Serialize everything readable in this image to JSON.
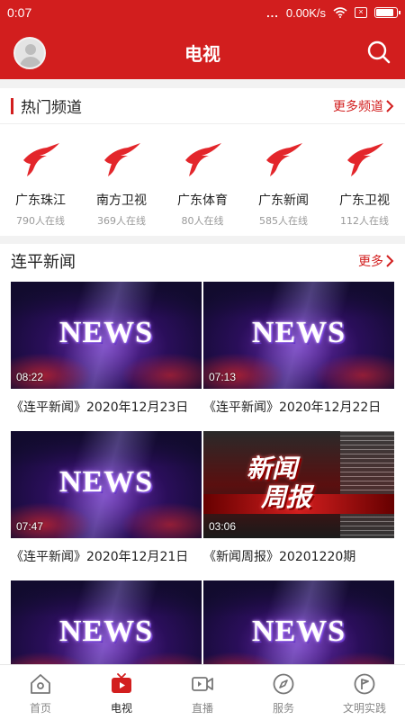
{
  "status_bar": {
    "time": "0:07",
    "signal_dots": "...",
    "net_speed": "0.00K/s",
    "battery_level": 0.9,
    "icons": [
      "wifi-icon",
      "sim-x-icon",
      "battery-icon"
    ]
  },
  "header": {
    "title": "电视",
    "left_icon": "avatar",
    "right_icon": "search-icon"
  },
  "hot_channels": {
    "title": "热门频道",
    "more_label": "更多频道",
    "items": [
      {
        "name": "广东珠江",
        "online": "790人在线"
      },
      {
        "name": "南方卫视",
        "online": "369人在线"
      },
      {
        "name": "广东体育",
        "online": "80人在线"
      },
      {
        "name": "广东新闻",
        "online": "585人在线"
      },
      {
        "name": "广东卫视",
        "online": "112人在线"
      }
    ]
  },
  "news_section": {
    "title": "连平新闻",
    "more_label": "更多",
    "videos": [
      {
        "title": "《连平新闻》2020年12月23日",
        "duration": "08:22",
        "thumb_text": "NEWS"
      },
      {
        "title": "《连平新闻》2020年12月22日",
        "duration": "07:13",
        "thumb_text": "NEWS"
      },
      {
        "title": "《连平新闻》2020年12月21日",
        "duration": "07:47",
        "thumb_text": "NEWS"
      },
      {
        "title": "《新闻周报》20201220期",
        "duration": "03:06",
        "thumb_text": "新闻周报"
      },
      {
        "title": "",
        "duration": "",
        "thumb_text": "NEWS"
      },
      {
        "title": "",
        "duration": "",
        "thumb_text": "NEWS"
      }
    ]
  },
  "tab_bar": {
    "items": [
      {
        "label": "首页",
        "icon": "home-icon",
        "active": false
      },
      {
        "label": "电视",
        "icon": "tv-icon",
        "active": true
      },
      {
        "label": "直播",
        "icon": "video-camera-icon",
        "active": false
      },
      {
        "label": "服务",
        "icon": "compass-icon",
        "active": false
      },
      {
        "label": "文明实践",
        "icon": "flag-circle-icon",
        "active": false
      }
    ]
  },
  "colors": {
    "brand": "#d21e1e",
    "text": "#222222",
    "muted": "#999999"
  }
}
